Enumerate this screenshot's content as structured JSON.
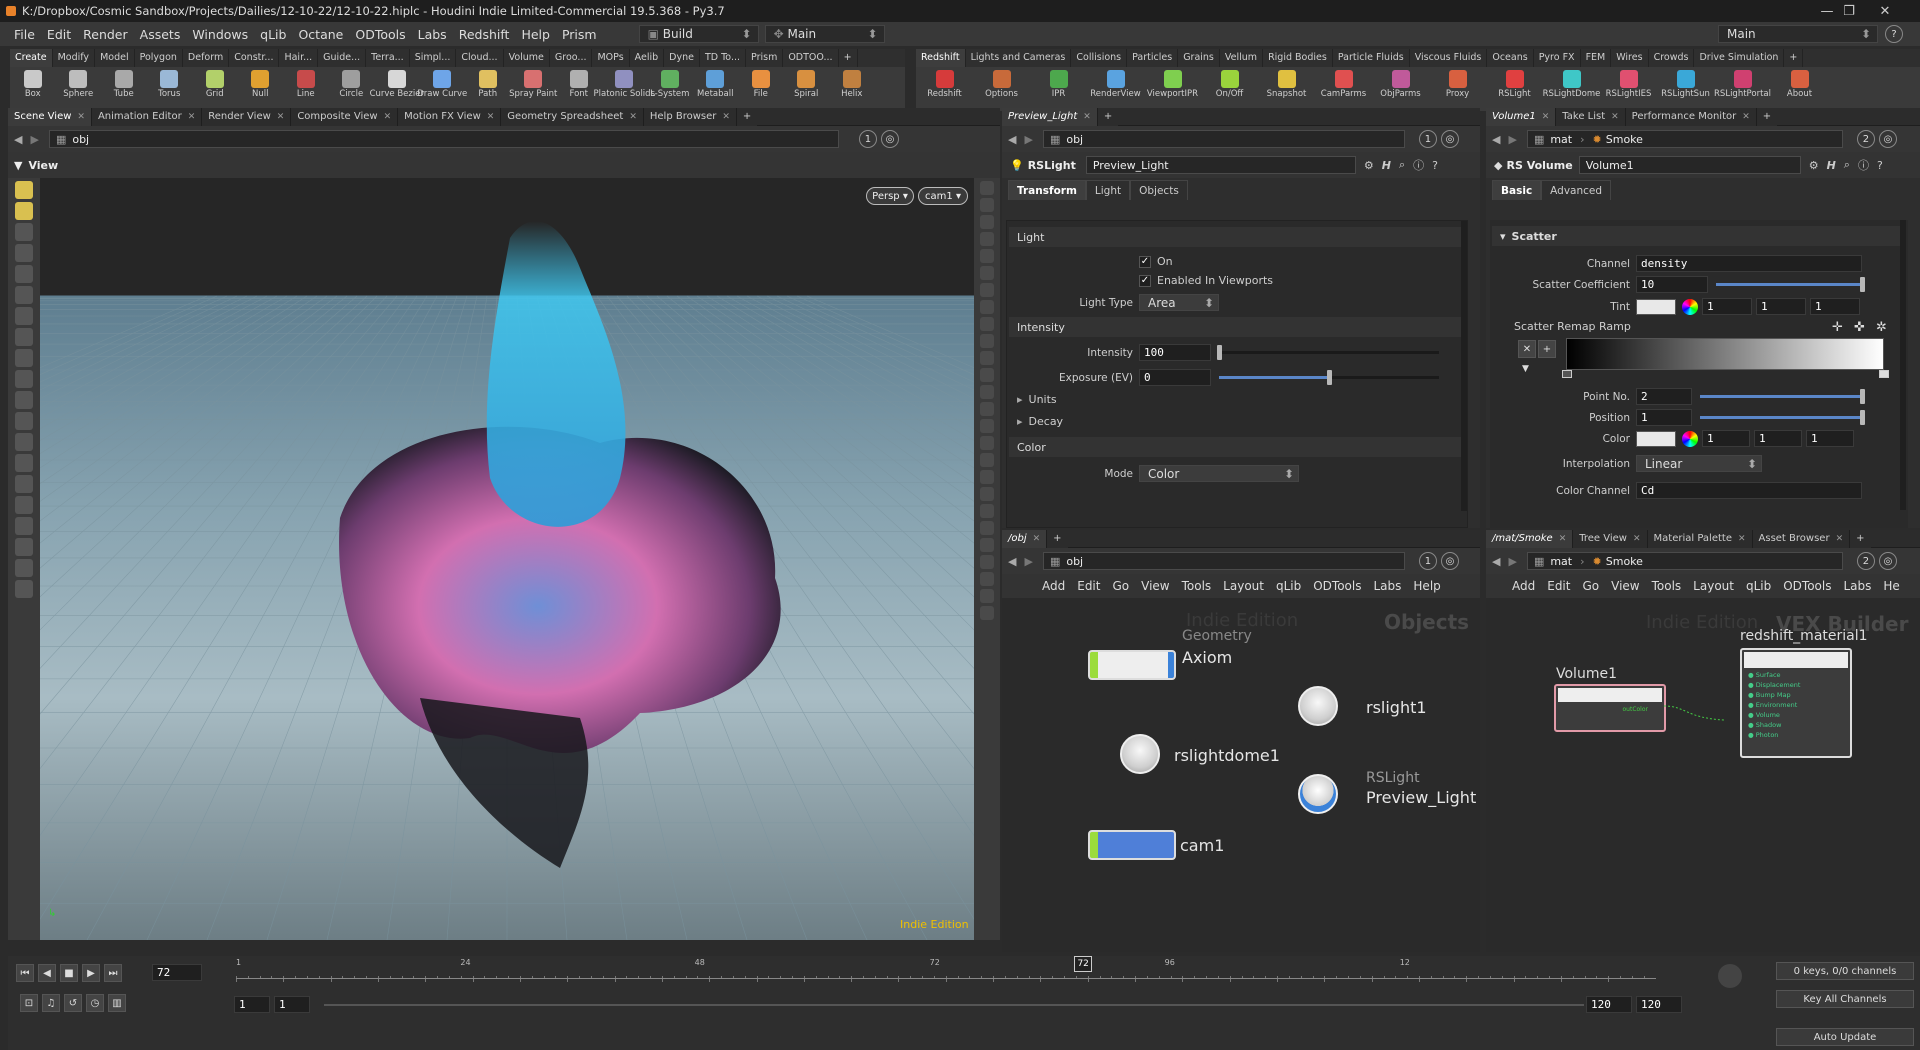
{
  "titlebar": {
    "title": "K:/Dropbox/Cosmic Sandbox/Projects/Dailies/12-10-22/12-10-22.hiplc - Houdini Indie Limited-Commercial 19.5.368 - Py3.7"
  },
  "menubar": {
    "items": [
      "File",
      "Edit",
      "Render",
      "Assets",
      "Windows",
      "qLib",
      "Octane",
      "ODTools",
      "Labs",
      "Redshift",
      "Help",
      "Prism"
    ],
    "build_label": "Build",
    "desktop_label": "Main",
    "right_desktop": "Main"
  },
  "shelf_left": {
    "tabs": [
      "Create",
      "Modify",
      "Model",
      "Polygon",
      "Deform",
      "Constr...",
      "Hair...",
      "Guide...",
      "Terra...",
      "Simpl...",
      "Cloud...",
      "Volume",
      "Groo...",
      "MOPs",
      "Aelib",
      "Dyne",
      "TD To...",
      "Prism",
      "ODTOO..."
    ],
    "tools": [
      "Box",
      "Sphere",
      "Tube",
      "Torus",
      "Grid",
      "Null",
      "Line",
      "Circle",
      "Curve Bezier",
      "Draw Curve",
      "Path",
      "Spray Paint",
      "Font",
      "Platonic Solids",
      "L-System",
      "Metaball",
      "File",
      "Spiral",
      "Helix"
    ]
  },
  "shelf_right": {
    "tabs": [
      "Redshift",
      "Lights and Cameras",
      "Collisions",
      "Particles",
      "Grains",
      "Vellum",
      "Rigid Bodies",
      "Particle Fluids",
      "Viscous Fluids",
      "Oceans",
      "Pyro FX",
      "FEM",
      "Wires",
      "Crowds",
      "Drive Simulation"
    ],
    "tools": [
      "Redshift",
      "Options",
      "IPR",
      "RenderView",
      "ViewportIPR",
      "On/Off",
      "Snapshot",
      "CamParms",
      "ObjParms",
      "Proxy",
      "RSLight",
      "RSLightDome",
      "RSLightIES",
      "RSLightSun",
      "RSLightPortal",
      "About"
    ]
  },
  "viewport": {
    "tabs": [
      "Scene View",
      "Animation Editor",
      "Render View",
      "Composite View",
      "Motion FX View",
      "Geometry Spreadsheet",
      "Help Browser"
    ],
    "path": "obj",
    "view_label": "View",
    "persp": "Persp",
    "camera": "cam1",
    "watermark": "Indie Edition"
  },
  "light_params": {
    "tab": "Preview_Light",
    "path": "obj",
    "node_type": "RSLight",
    "node_name": "Preview_Light",
    "subtabs": [
      "Transform",
      "Light",
      "Objects"
    ],
    "light_section": "Light",
    "on_label": "On",
    "viewports_label": "Enabled In Viewports",
    "light_type_label": "Light Type",
    "light_type_value": "Area",
    "intensity_section": "Intensity",
    "intensity_label": "Intensity",
    "intensity_value": "100",
    "intensity_level": 0.0,
    "exposure_label": "Exposure (EV)",
    "exposure_value": "0",
    "exposure_level": 0.5,
    "units_label": "Units",
    "decay_label": "Decay",
    "color_section": "Color",
    "mode_label": "Mode",
    "mode_value": "Color"
  },
  "volume_params": {
    "tabs": [
      "Volume1",
      "Take List",
      "Performance Monitor"
    ],
    "path_mat": "mat",
    "path_smoke": "Smoke",
    "node_type": "RS Volume",
    "node_name": "Volume1",
    "subtabs": [
      "Basic",
      "Advanced"
    ],
    "scatter_section": "Scatter",
    "channel_label": "Channel",
    "channel_value": "density",
    "coef_label": "Scatter Coefficient",
    "coef_value": "10",
    "coef_level": 1.0,
    "tint_label": "Tint",
    "tint_values": [
      "1",
      "1",
      "1"
    ],
    "ramp_label": "Scatter Remap Ramp",
    "point_label": "Point No.",
    "point_value": "2",
    "position_label": "Position",
    "position_value": "1",
    "color_label": "Color",
    "color_values": [
      "1",
      "1",
      "1"
    ],
    "interp_label": "Interpolation",
    "interp_value": "Linear",
    "color_channel_label": "Color Channel",
    "color_channel_value": "Cd"
  },
  "network_obj": {
    "tab": "/obj",
    "path": "obj",
    "menu": [
      "Add",
      "Edit",
      "Go",
      "View",
      "Tools",
      "Layout",
      "qLib",
      "ODTools",
      "Labs",
      "Help"
    ],
    "watermark": "Indie Edition",
    "context": "Objects",
    "nodes": {
      "axiom_type": "Geometry",
      "axiom_name": "Axiom",
      "rslight1": "rslight1",
      "rslightdome1": "rslightdome1",
      "preview_type": "RSLight",
      "preview_name": "Preview_Light",
      "cam1": "cam1"
    }
  },
  "network_mat": {
    "tabs": [
      "/mat/Smoke",
      "Tree View",
      "Material Palette",
      "Asset Browser"
    ],
    "path_mat": "mat",
    "path_smoke": "Smoke",
    "menu": [
      "Add",
      "Edit",
      "Go",
      "View",
      "Tools",
      "Layout",
      "qLib",
      "ODTools",
      "Labs",
      "He"
    ],
    "watermark": "Indie Edition",
    "context": "VEX Builder",
    "volume_node": "Volume1",
    "volume_port": "outColor",
    "material_node": "redshift_material1",
    "material_inputs": [
      "Surface",
      "Displacement",
      "Bump Map",
      "Environment",
      "Volume",
      "Shadow",
      "Photon"
    ]
  },
  "timeline": {
    "frame": "72",
    "ticks": [
      "1",
      "24",
      "48",
      "72",
      "96",
      "12"
    ],
    "start": "1",
    "start2": "1",
    "end": "120",
    "end2": "120",
    "current_fraction": 0.5966,
    "keys_label": "0 keys, 0/0 channels",
    "key_all": "Key All Channels",
    "auto_update": "Auto Update"
  }
}
